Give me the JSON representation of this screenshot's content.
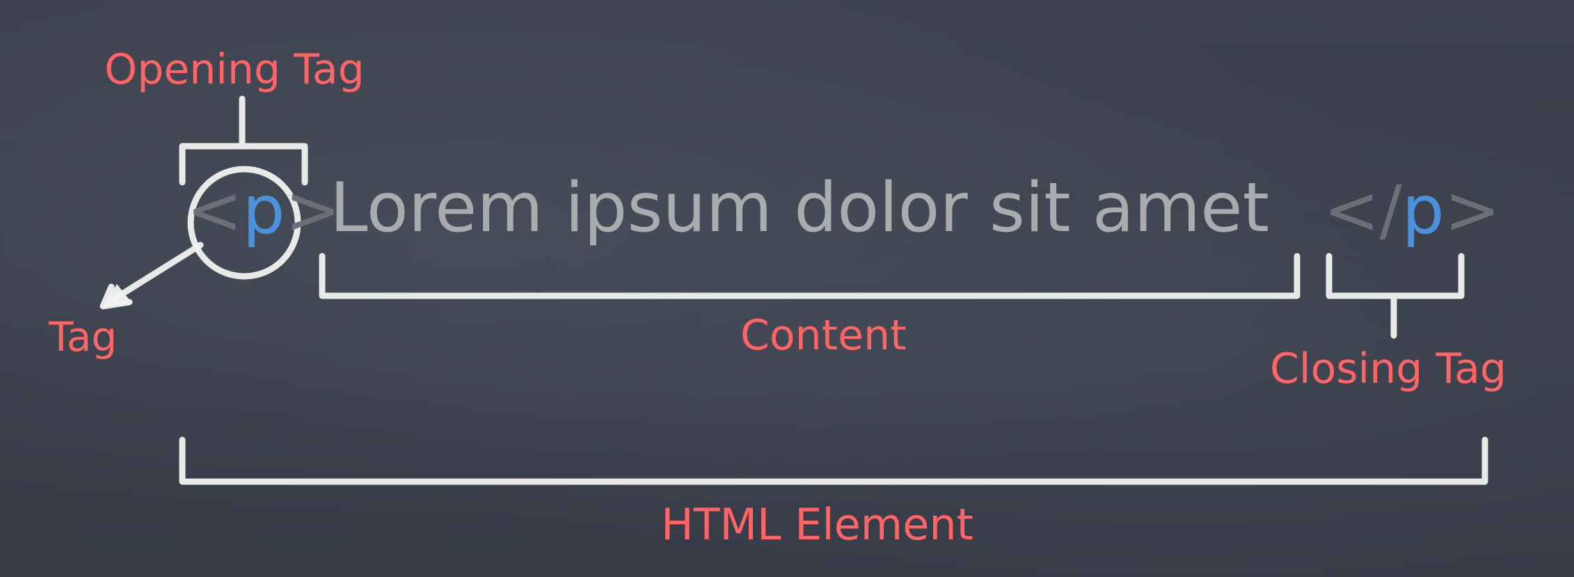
{
  "labels": {
    "opening_tag": "Opening Tag",
    "tag": "Tag",
    "content": "Content",
    "closing_tag": "Closing Tag",
    "html_element": "HTML Element"
  },
  "code": {
    "open_lt": "<",
    "open_name": "p",
    "open_gt": ">",
    "content": "Lorem ipsum dolor sit amet",
    "close_lt": "</",
    "close_name": "p",
    "close_gt": ">"
  },
  "colors": {
    "label": "#ff6466",
    "tag_name": "#4a92dd",
    "bracket": "#6b6f78",
    "content_text": "#a9abaf",
    "chalk": "#f2f2f0",
    "board": "#3a3f4b"
  }
}
